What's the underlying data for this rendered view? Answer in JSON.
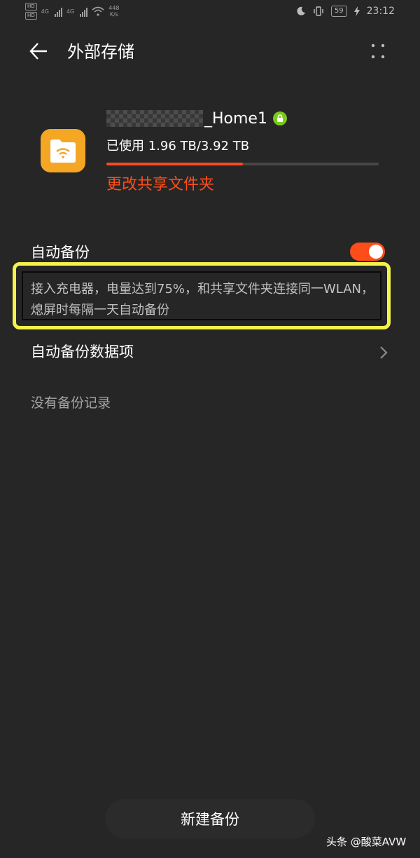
{
  "status_bar": {
    "hd1": "HD",
    "hd2": "HD",
    "sig1_type": "4G",
    "sig2_type": "4G",
    "speed_value": "448",
    "speed_unit": "K/s",
    "battery": "59",
    "time": "23:12"
  },
  "header": {
    "title": "外部存储"
  },
  "storage": {
    "device_name_suffix": "_Home1",
    "used_text": "已使用 1.96 TB/3.92 TB",
    "used_fraction": 0.5,
    "change_folder_label": "更改共享文件夹"
  },
  "auto_backup": {
    "label": "自动备份",
    "enabled": true,
    "description": "接入充电器，电量达到75%，和共享文件夹连接同一WLAN，熄屏时每隔一天自动备份"
  },
  "data_items": {
    "label": "自动备份数据项"
  },
  "history": {
    "empty_text": "没有备份记录"
  },
  "footer": {
    "new_backup_label": "新建备份",
    "watermark": "头条 @酸菜AVW"
  },
  "colors": {
    "accent": "#ff4d1a",
    "background": "#262626",
    "highlight": "#f4f34b",
    "folder_icon": "#f5a623",
    "lock_badge": "#7cc91c"
  }
}
